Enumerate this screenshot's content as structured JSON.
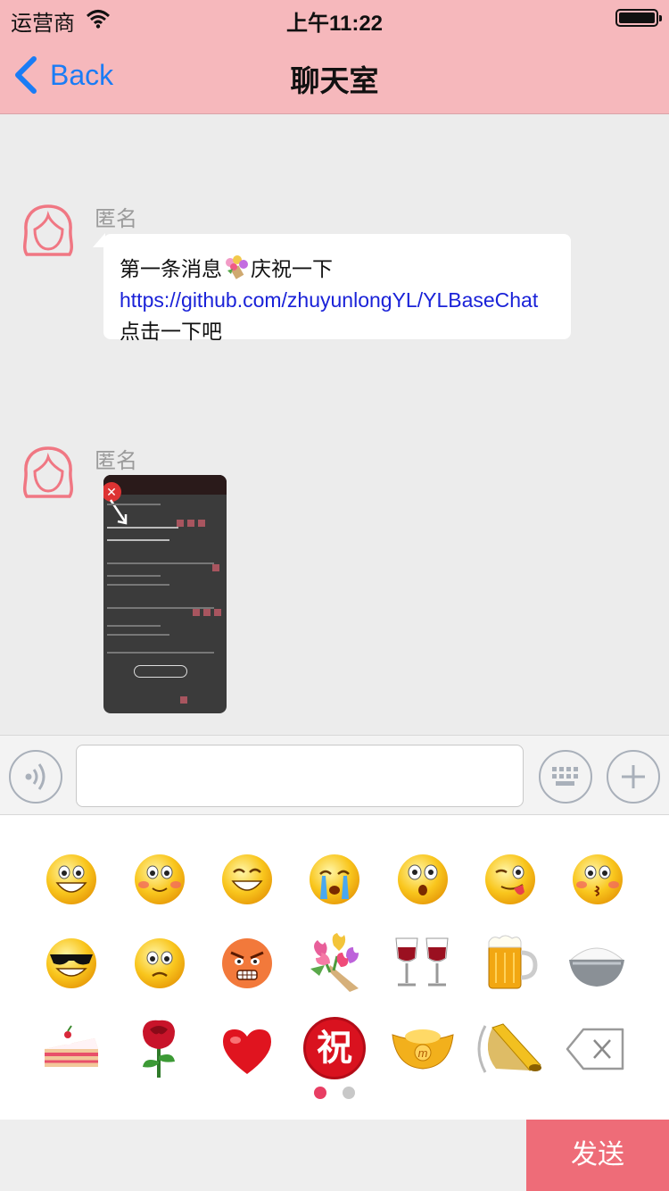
{
  "status_bar": {
    "carrier": "运营商",
    "time": "上午11:22"
  },
  "nav": {
    "back_label": "Back",
    "title": "聊天室"
  },
  "messages": [
    {
      "sender": "匿名",
      "text_before": "第一条消息",
      "text_after_emoji": "庆祝一下",
      "link": "https://github.com/zhuyunlongYL/YLBaseChat",
      "text_end": " 点击一下吧"
    },
    {
      "sender": "匿名",
      "type": "image"
    }
  ],
  "input": {
    "value": "",
    "placeholder": ""
  },
  "emoji_panel": {
    "rows": [
      [
        "grin-face-icon",
        "blush-face-icon",
        "smile-face-icon",
        "crying-face-icon",
        "surprised-face-icon",
        "tongue-face-icon",
        "kiss-face-icon"
      ],
      [
        "sunglasses-face-icon",
        "sad-face-icon",
        "angry-face-icon",
        "flowers-icon",
        "wine-glasses-icon",
        "beer-mug-icon",
        "rice-bowl-icon"
      ],
      [
        "cake-icon",
        "rose-icon",
        "heart-icon",
        "blessing-icon",
        "gold-ingot-icon",
        "megaphone-icon",
        "backspace-icon"
      ]
    ],
    "blessing_char": "祝",
    "page_count": 2,
    "current_page": 1
  },
  "send_label": "发送",
  "colors": {
    "nav_bg": "#f6b8bc",
    "link": "#1a22d8",
    "back": "#1a7cf5",
    "avatar": "#f07783",
    "send_bg": "#ee6c78",
    "dot_active": "#e83e63",
    "dot_inactive": "#c8c8c8"
  }
}
